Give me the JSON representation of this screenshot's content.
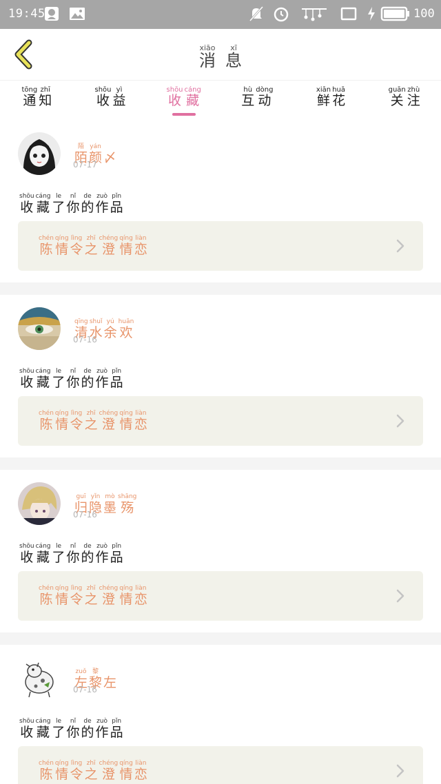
{
  "status_bar": {
    "time": "19:45",
    "battery_level": "100",
    "icons": [
      "qq-icon",
      "image-icon",
      "mute-icon",
      "alarm-icon",
      "signal-icon",
      "window-icon",
      "charging-icon",
      "battery-icon"
    ]
  },
  "header": {
    "back_icon": "chevron-left-icon",
    "title": [
      {
        "py": "xiāo",
        "hz": "消"
      },
      {
        "py": "xī",
        "hz": "息"
      }
    ]
  },
  "tabs": [
    {
      "active": false,
      "chars": [
        {
          "py": "tōng",
          "hz": "通"
        },
        {
          "py": "zhī",
          "hz": "知"
        }
      ]
    },
    {
      "active": false,
      "chars": [
        {
          "py": "shōu",
          "hz": "收"
        },
        {
          "py": "yì",
          "hz": "益"
        }
      ]
    },
    {
      "active": true,
      "chars": [
        {
          "py": "shōu",
          "hz": "收"
        },
        {
          "py": "cáng",
          "hz": "藏"
        }
      ]
    },
    {
      "active": false,
      "chars": [
        {
          "py": "hù",
          "hz": "互"
        },
        {
          "py": "dòng",
          "hz": "动"
        }
      ]
    },
    {
      "active": false,
      "chars": [
        {
          "py": "xiān",
          "hz": "鲜"
        },
        {
          "py": "huā",
          "hz": "花"
        }
      ]
    },
    {
      "active": false,
      "chars": [
        {
          "py": "guān",
          "hz": "关"
        },
        {
          "py": "zhù",
          "hz": "注"
        }
      ]
    }
  ],
  "colors": {
    "accent_pink": "#e070a0",
    "accent_orange": "#e8946a",
    "card_bg": "#f2f2ea",
    "status_bar": "#a6a6a6"
  },
  "notifications": [
    {
      "avatar": "anime-girl-avatar",
      "user": [
        {
          "py": "陌",
          "hz": "陌"
        },
        {
          "py": "yán",
          "hz": "颜"
        },
        {
          "py": "",
          "hz": "〆"
        }
      ],
      "date": "07-17",
      "action": [
        {
          "py": "shōu",
          "hz": "收"
        },
        {
          "py": "cáng",
          "hz": "藏"
        },
        {
          "py": "le",
          "hz": "了"
        },
        {
          "py": "nǐ",
          "hz": "你"
        },
        {
          "py": "de",
          "hz": "的"
        },
        {
          "py": "zuò",
          "hz": "作"
        },
        {
          "py": "pǐn",
          "hz": "品"
        }
      ],
      "work": [
        {
          "py": "chén",
          "hz": "陈"
        },
        {
          "py": "qíng",
          "hz": "情"
        },
        {
          "py": "lìng",
          "hz": "令"
        },
        {
          "py": "zhī",
          "hz": "之"
        },
        {
          "py": "chéng",
          "hz": "澄"
        },
        {
          "py": "qíng",
          "hz": "情"
        },
        {
          "py": "liàn",
          "hz": "恋"
        }
      ]
    },
    {
      "avatar": "green-eye-avatar",
      "user": [
        {
          "py": "qīng",
          "hz": "清"
        },
        {
          "py": "shuǐ",
          "hz": "水"
        },
        {
          "py": "yú",
          "hz": "余"
        },
        {
          "py": "huān",
          "hz": "欢"
        }
      ],
      "date": "07-16",
      "action": [
        {
          "py": "shōu",
          "hz": "收"
        },
        {
          "py": "cáng",
          "hz": "藏"
        },
        {
          "py": "le",
          "hz": "了"
        },
        {
          "py": "nǐ",
          "hz": "你"
        },
        {
          "py": "de",
          "hz": "的"
        },
        {
          "py": "zuò",
          "hz": "作"
        },
        {
          "py": "pǐn",
          "hz": "品"
        }
      ],
      "work": [
        {
          "py": "chén",
          "hz": "陈"
        },
        {
          "py": "qíng",
          "hz": "情"
        },
        {
          "py": "lìng",
          "hz": "令"
        },
        {
          "py": "zhī",
          "hz": "之"
        },
        {
          "py": "chéng",
          "hz": "澄"
        },
        {
          "py": "qíng",
          "hz": "情"
        },
        {
          "py": "liàn",
          "hz": "恋"
        }
      ]
    },
    {
      "avatar": "blonde-boy-avatar",
      "user": [
        {
          "py": "guī",
          "hz": "归"
        },
        {
          "py": "yǐn",
          "hz": "隐"
        },
        {
          "py": "mò",
          "hz": "墨"
        },
        {
          "py": "shāng",
          "hz": "殇"
        }
      ],
      "date": "07-16",
      "action": [
        {
          "py": "shōu",
          "hz": "收"
        },
        {
          "py": "cáng",
          "hz": "藏"
        },
        {
          "py": "le",
          "hz": "了"
        },
        {
          "py": "nǐ",
          "hz": "你"
        },
        {
          "py": "de",
          "hz": "的"
        },
        {
          "py": "zuò",
          "hz": "作"
        },
        {
          "py": "pǐn",
          "hz": "品"
        }
      ],
      "work": [
        {
          "py": "chén",
          "hz": "陈"
        },
        {
          "py": "qíng",
          "hz": "情"
        },
        {
          "py": "lìng",
          "hz": "令"
        },
        {
          "py": "zhī",
          "hz": "之"
        },
        {
          "py": "chéng",
          "hz": "澄"
        },
        {
          "py": "qíng",
          "hz": "情"
        },
        {
          "py": "liàn",
          "hz": "恋"
        }
      ]
    },
    {
      "avatar": "cartoon-animal-avatar",
      "user": [
        {
          "py": "zuǒ",
          "hz": "左"
        },
        {
          "py": "黎",
          "hz": "黎"
        },
        {
          "py": "",
          "hz": "左"
        }
      ],
      "date": "07-16",
      "action": [
        {
          "py": "shōu",
          "hz": "收"
        },
        {
          "py": "cáng",
          "hz": "藏"
        },
        {
          "py": "le",
          "hz": "了"
        },
        {
          "py": "nǐ",
          "hz": "你"
        },
        {
          "py": "de",
          "hz": "的"
        },
        {
          "py": "zuò",
          "hz": "作"
        },
        {
          "py": "pǐn",
          "hz": "品"
        }
      ],
      "work": [
        {
          "py": "chén",
          "hz": "陈"
        },
        {
          "py": "qíng",
          "hz": "情"
        },
        {
          "py": "lìng",
          "hz": "令"
        },
        {
          "py": "zhī",
          "hz": "之"
        },
        {
          "py": "chéng",
          "hz": "澄"
        },
        {
          "py": "qíng",
          "hz": "情"
        },
        {
          "py": "liàn",
          "hz": "恋"
        }
      ]
    }
  ]
}
